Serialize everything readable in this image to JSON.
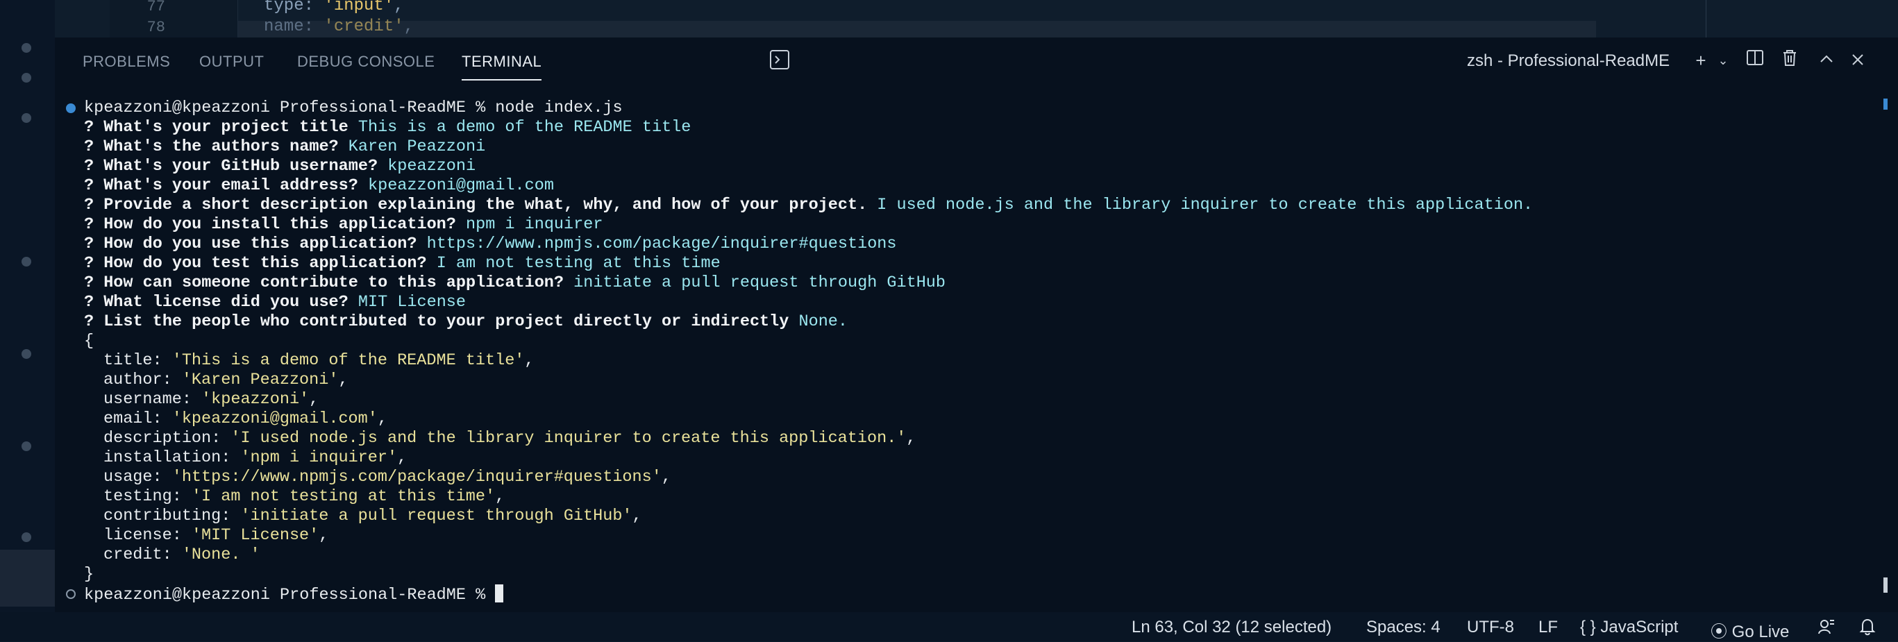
{
  "editor": {
    "lines": [
      {
        "num": "77",
        "key": "type: ",
        "value": "'input'",
        "tail": ","
      },
      {
        "num": "78",
        "key": "name: ",
        "value": "'credit'",
        "tail": ","
      }
    ]
  },
  "panel": {
    "tabs": [
      "PROBLEMS",
      "OUTPUT",
      "DEBUG CONSOLE",
      "TERMINAL"
    ],
    "active_tab": "TERMINAL",
    "terminal_name": "zsh - Professional-ReadME"
  },
  "terminal": {
    "command_line": "kpeazzoni@kpeazzoni Professional-ReadME % node index.js",
    "questions": [
      {
        "q": "? What's your project title",
        "a": "This is a demo of the README title"
      },
      {
        "q": "? What's the authors name?",
        "a": "Karen Peazzoni"
      },
      {
        "q": "? What's your GitHub username?",
        "a": "kpeazzoni"
      },
      {
        "q": "? What's your email address?",
        "a": "kpeazzoni@gmail.com"
      },
      {
        "q": "? Provide a short description explaining the what, why, and how of your project.",
        "a": "I used node.js and the library inquirer to create this application."
      },
      {
        "q": "? How do you install this application?",
        "a": "npm i inquirer"
      },
      {
        "q": "? How do you use this application?",
        "a": "https://www.npmjs.com/package/inquirer#questions"
      },
      {
        "q": "? How do you test this application?",
        "a": "I am not testing at this time"
      },
      {
        "q": "? How can someone contribute to this application?",
        "a": "initiate a pull request through GitHub"
      },
      {
        "q": "? What license did you use?",
        "a": "MIT License"
      },
      {
        "q": "? List the people who contributed to your project directly or indirectly",
        "a": "None."
      }
    ],
    "open_brace": "{",
    "object": [
      {
        "key": "title: ",
        "value": "'This is a demo of the README title'",
        "tail": ","
      },
      {
        "key": "author: ",
        "value": "'Karen Peazzoni'",
        "tail": ","
      },
      {
        "key": "username: ",
        "value": "'kpeazzoni'",
        "tail": ","
      },
      {
        "key": "email: ",
        "value": "'kpeazzoni@gmail.com'",
        "tail": ","
      },
      {
        "key": "description: ",
        "value": "'I used node.js and the library inquirer to create this application.'",
        "tail": ","
      },
      {
        "key": "installation: ",
        "value": "'npm i inquirer'",
        "tail": ","
      },
      {
        "key": "usage: ",
        "value": "'https://www.npmjs.com/package/inquirer#questions'",
        "tail": ","
      },
      {
        "key": "testing: ",
        "value": "'I am not testing at this time'",
        "tail": ","
      },
      {
        "key": "contributing: ",
        "value": "'initiate a pull request through GitHub'",
        "tail": ","
      },
      {
        "key": "license: ",
        "value": "'MIT License'",
        "tail": ","
      },
      {
        "key": "credit: ",
        "value": "'None. '",
        "tail": ""
      }
    ],
    "close_brace": "}",
    "final_prompt": "kpeazzoni@kpeazzoni Professional-ReadME % "
  },
  "status": {
    "position": "Ln 63, Col 32 (12 selected)",
    "spaces": "Spaces: 4",
    "encoding": "UTF-8",
    "eol": "LF",
    "language": "JavaScript",
    "go_live": "Go Live"
  },
  "colors": {
    "accent": "#3a8ad3",
    "answer": "#9be7f0",
    "string": "#e9e19a"
  }
}
